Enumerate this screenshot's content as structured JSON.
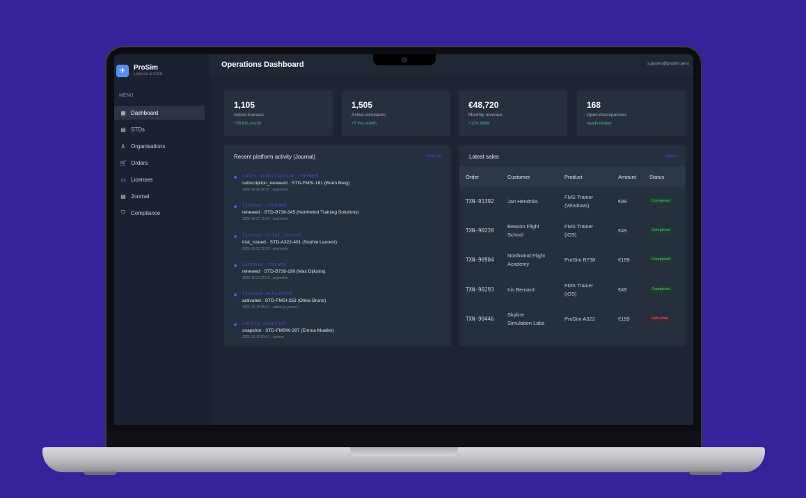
{
  "brand": {
    "name": "ProSim",
    "subtitle": "License & CMS"
  },
  "sidebar": {
    "menu_label": "MENU",
    "items": [
      {
        "label": "Dashboard",
        "icon": "grid-icon",
        "active": true
      },
      {
        "label": "STDs",
        "icon": "server-icon"
      },
      {
        "label": "Organisations",
        "icon": "user-icon"
      },
      {
        "label": "Orders",
        "icon": "cart-icon"
      },
      {
        "label": "Licenses",
        "icon": "key-card-icon"
      },
      {
        "label": "Journal",
        "icon": "document-icon"
      },
      {
        "label": "Compliance",
        "icon": "shield-check-icon"
      }
    ]
  },
  "header": {
    "title": "Operations Dashboard",
    "user_email": "s.jansen@prosim.aero"
  },
  "stats": [
    {
      "value": "1,105",
      "label": "Active licenses",
      "note": "+38 this month"
    },
    {
      "value": "1,505",
      "label": "Active simulators",
      "note": "+5 this month"
    },
    {
      "value": "€48,720",
      "label": "Monthly revenue",
      "note": "+12% MoM"
    },
    {
      "value": "168",
      "label": "Open discrepancies",
      "note": "needs review"
    }
  ],
  "activity": {
    "title": "Recent platform activity (Journal)",
    "link": "View all",
    "items": [
      {
        "event": "sales.subscription_renewed",
        "desc": "subscription_renewed · STD-FMSI-181 (Bram Berg)",
        "meta": "2026-12-28 00:07 · payments"
      },
      {
        "event": "license.renewed",
        "desc": "renewed · STD-B738-345 (Northwind Training Solutions)",
        "meta": "2026-12-27 15:23 · payments"
      },
      {
        "event": "license.trial_issued",
        "desc": "trial_issued · STD-A322-401 (Sophie Laurent)",
        "meta": "2026-12-22 20:20 · payments"
      },
      {
        "event": "license.renewed",
        "desc": "renewed · STD-B738-190 (Max Dijkstra)",
        "meta": "2026-12-21 22:12 · payments"
      },
      {
        "event": "license.activated",
        "desc": "activated · STD-FMSI-253 (Olivia Bruno)",
        "meta": "2026-12-19 05:51 · admin (s.jansen)"
      },
      {
        "event": "config.snapshot",
        "desc": "snapshot · STD-FMSW-397 (Emma Mueller)",
        "meta": "2026-12-19 01:41 · system"
      }
    ]
  },
  "sales": {
    "title": "Latest sales",
    "link": "Open",
    "columns": [
      "Order",
      "Customer",
      "Product",
      "Amount",
      "Status"
    ],
    "rows": [
      {
        "order": "TXN-91392",
        "customer": [
          "Jan Hendriks"
        ],
        "product": [
          "FMS Trainer",
          "(Windows)"
        ],
        "amount": "€89",
        "status": "Completed"
      },
      {
        "order": "TXN-90220",
        "customer": [
          "Beacon Flight",
          "School"
        ],
        "product": [
          "FMS Trainer",
          "(iOS)"
        ],
        "amount": "€49",
        "status": "Completed"
      },
      {
        "order": "TXN-90904",
        "customer": [
          "Northwind Flight",
          "Academy"
        ],
        "product": [
          "ProSim B738"
        ],
        "amount": "€199",
        "status": "Completed"
      },
      {
        "order": "TXN-90293",
        "customer": [
          "Iris Bernard"
        ],
        "product": [
          "FMS Trainer",
          "(iOS)"
        ],
        "amount": "€49",
        "status": "Completed"
      },
      {
        "order": "TXN-90446",
        "customer": [
          "Skyline",
          "Simulation Labs"
        ],
        "product": [
          "ProSim A322"
        ],
        "amount": "€199",
        "status": "Refunded"
      }
    ]
  }
}
